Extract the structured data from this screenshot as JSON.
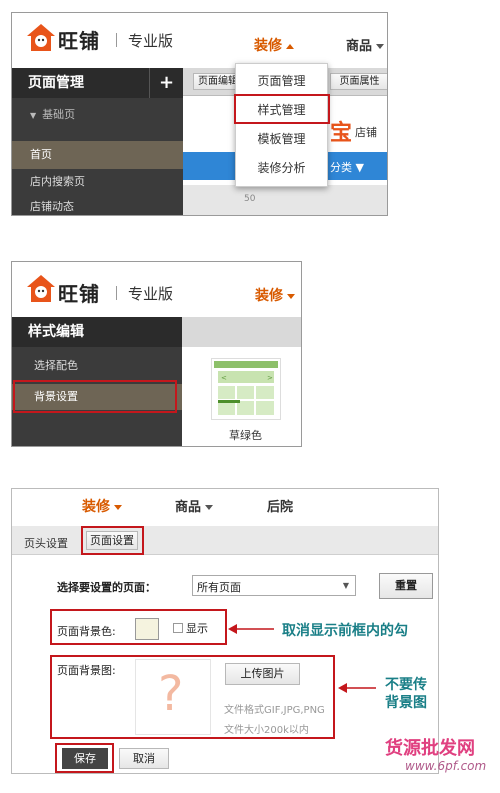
{
  "panel1": {
    "brand": "旺铺",
    "edition": "专业版",
    "nav_decorate": "装修",
    "nav_goods": "商品",
    "sidebar_title": "页面管理",
    "sidebar_add": "+",
    "sidebar_group": "基础页",
    "sidebar_items": [
      "首页",
      "店内搜索页",
      "店铺动态"
    ],
    "tab_edit": "页面编辑",
    "tab_props": "页面属性",
    "shop_label": "店铺",
    "category_label": "分类",
    "ruler_value": "50",
    "dropdown_items": [
      "页面管理",
      "样式管理",
      "模板管理",
      "装修分析"
    ]
  },
  "panel2": {
    "brand": "旺铺",
    "edition": "专业版",
    "nav_decorate": "装修",
    "sidebar_title": "样式编辑",
    "sidebar_items": [
      "选择配色",
      "背景设置"
    ],
    "theme_name": "草绿色"
  },
  "panel3": {
    "nav_decorate": "装修",
    "nav_goods": "商品",
    "nav_backyard": "后院",
    "tab_header": "页头设置",
    "tab_page": "页面设置",
    "select_label": "选择要设置的页面：",
    "select_value": "所有页面",
    "reset_button": "重置",
    "bg_color_label": "页面背景色:",
    "show_label": "显示",
    "bg_image_label": "页面背景图:",
    "upload_button": "上传图片",
    "placeholder_mark": "?",
    "format_hint": "文件格式GIF,JPG,PNG",
    "size_hint": "文件大小200k以内",
    "save_button": "保存",
    "cancel_button": "取消"
  },
  "annotations": {
    "uncheck_note": "取消显示前框内的勾",
    "no_upload_note_line1": "不要传",
    "no_upload_note_line2": "背景图"
  },
  "watermark": {
    "line1": "货源批发网",
    "line2": "www.6pf.com"
  },
  "colors": {
    "accent_orange": "#d85a00",
    "highlight_red": "#c4171c",
    "sidebar_dark": "#3b3b3b",
    "sidebar_selected": "#6e6555",
    "blue_bar": "#2f86d6",
    "annotation_teal": "#1a7f87",
    "watermark_pink": "#e04080"
  }
}
